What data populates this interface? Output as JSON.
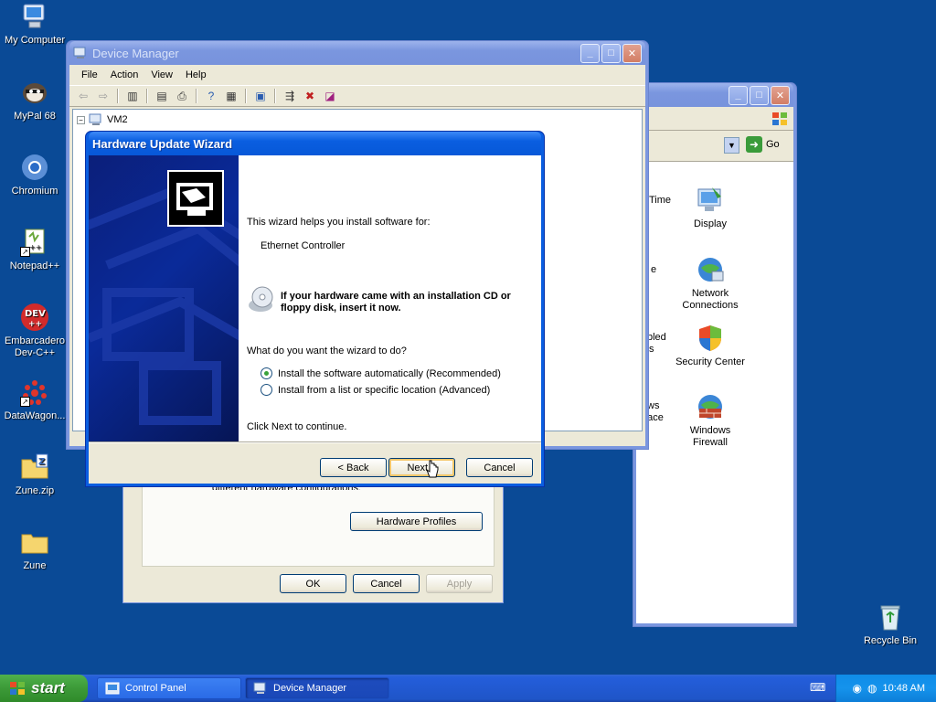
{
  "desktop": {
    "icons": [
      {
        "label": "My Computer"
      },
      {
        "label": "MyPal 68"
      },
      {
        "label": "Chromium"
      },
      {
        "label": "Notepad++"
      },
      {
        "label": "Embarcadero Dev-C++"
      },
      {
        "label": "DataWagon..."
      },
      {
        "label": "Zune.zip"
      },
      {
        "label": "Zune"
      },
      {
        "label": "Recycle Bin"
      }
    ]
  },
  "device_manager": {
    "title": "Device Manager",
    "menu": [
      "File",
      "Action",
      "View",
      "Help"
    ],
    "tree_root": "VM2"
  },
  "control_panel": {
    "go_label": "Go",
    "items": [
      {
        "label": "Time"
      },
      {
        "label": "Display"
      },
      {
        "label": "Network Connections"
      },
      {
        "label": "Security Center"
      },
      {
        "label": "Windows Firewall"
      }
    ],
    "partial_labels": [
      "e",
      "bled",
      "s",
      "ws",
      "ce/Space"
    ]
  },
  "system_props": {
    "behind_text": "different hardware configurations.",
    "hardware_profiles_label": "Hardware Profiles",
    "ok_label": "OK",
    "cancel_label": "Cancel",
    "apply_label": "Apply"
  },
  "wizard": {
    "title": "Hardware Update Wizard",
    "intro": "This wizard helps you install software for:",
    "device": "Ethernet Controller",
    "cd_note": "If your hardware came with an installation CD or floppy disk, insert it now.",
    "question": "What do you want the wizard to do?",
    "options": [
      {
        "label": "Install the software automatically (Recommended)",
        "selected": true
      },
      {
        "label": "Install from a list or specific location (Advanced)",
        "selected": false
      }
    ],
    "continue_text": "Click Next to continue.",
    "back_label": "< Back",
    "next_label": "Next >",
    "cancel_label": "Cancel"
  },
  "taskbar": {
    "start_label": "start",
    "tasks": [
      {
        "label": "Control Panel"
      },
      {
        "label": "Device Manager"
      }
    ],
    "clock": "10:48 AM"
  },
  "colors": {
    "desktop": "#0a4a96",
    "title_active": "#0a5ee0",
    "taskbar": "#245edb",
    "start": "#3c9a38"
  }
}
